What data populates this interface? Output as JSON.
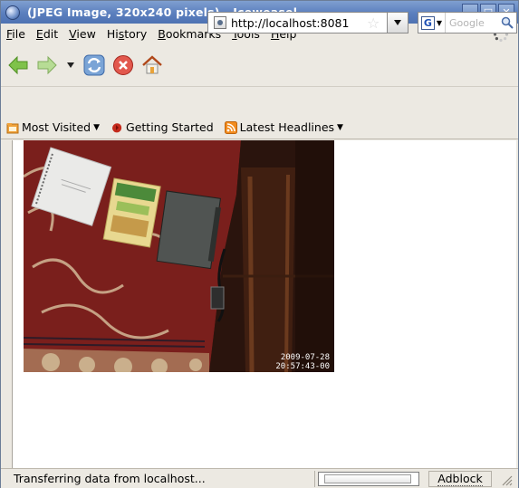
{
  "window": {
    "title": "(JPEG Image, 320x240 pixels) - Iceweasel",
    "buttons": {
      "minimize": "_",
      "maximize": "□",
      "close": "✕"
    }
  },
  "menubar": {
    "items": [
      {
        "label": "File",
        "accel": "F",
        "rest": "ile"
      },
      {
        "label": "Edit",
        "accel": "E",
        "rest": "dit"
      },
      {
        "label": "View",
        "accel": "V",
        "rest": "iew"
      },
      {
        "label": "History",
        "pre": "Hi",
        "accel": "s",
        "rest": "tory"
      },
      {
        "label": "Bookmarks",
        "accel": "B",
        "rest": "ookmarks"
      },
      {
        "label": "Tools",
        "accel": "T",
        "rest": "ools"
      },
      {
        "label": "Help",
        "accel": "H",
        "rest": "elp"
      }
    ]
  },
  "navbar": {
    "url": "http://localhost:8081",
    "search_placeholder": "Google",
    "search_engine_letter": "G"
  },
  "bookmarks": {
    "items": [
      {
        "label": "Most Visited",
        "has_menu": true,
        "icon": "folder-icon"
      },
      {
        "label": "Getting Started",
        "has_menu": false,
        "icon": "firefox-icon"
      },
      {
        "label": "Latest Headlines",
        "has_menu": true,
        "icon": "rss-icon"
      }
    ]
  },
  "content": {
    "image_timestamp_date": "2009-07-28",
    "image_timestamp_time": "20:57:43-00"
  },
  "statusbar": {
    "status_text": "Transferring data from localhost...",
    "progress_fraction": 0.0,
    "adblock_label": "Adblock"
  },
  "colors": {
    "titlebar": "#5b7fbe",
    "chrome": "#ece9e2",
    "carpet": "#7a1f1c"
  }
}
